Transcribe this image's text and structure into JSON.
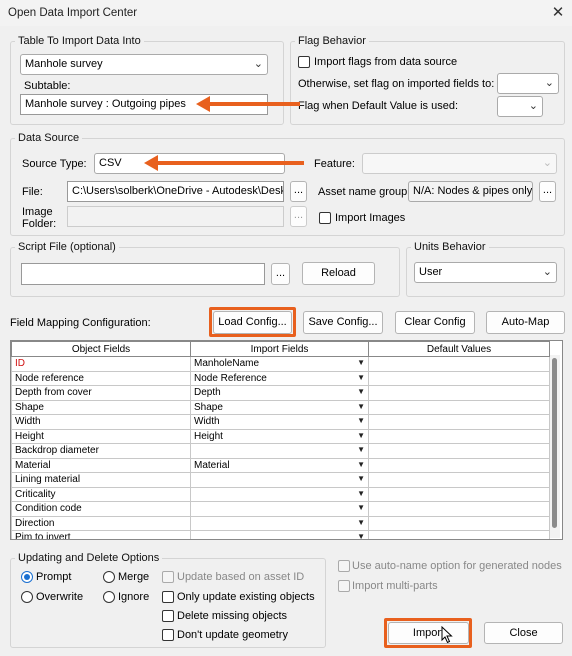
{
  "window": {
    "title": "Open Data Import Center",
    "close_glyph": "✕"
  },
  "table_group": {
    "legend": "Table To Import Data Into",
    "table_value": "Manhole survey",
    "subtable_label": "Subtable:",
    "subtable_value": "Manhole survey : Outgoing pipes"
  },
  "flag_group": {
    "legend": "Flag Behavior",
    "import_flags_label": "Import flags from data source",
    "otherwise_label": "Otherwise, set flag on imported fields to:",
    "default_value_label": "Flag when Default Value is used:"
  },
  "data_source": {
    "legend": "Data Source",
    "source_type_label": "Source Type:",
    "source_type_value": "CSV",
    "feature_label": "Feature:",
    "file_label": "File:",
    "file_value": "C:\\Users\\solberk\\OneDrive - Autodesk\\Desktop",
    "browse_label": "...",
    "asset_name_label": "Asset name group:",
    "asset_name_value": "N/A: Nodes & pipes only",
    "image_folder_label": "Image Folder:",
    "import_images_label": "Import Images"
  },
  "script_group": {
    "legend": "Script File (optional)",
    "browse_label": "...",
    "reload_label": "Reload"
  },
  "units_group": {
    "legend": "Units Behavior",
    "value": "User"
  },
  "mapping": {
    "label": "Field Mapping Configuration:",
    "load_config": "Load Config...",
    "save_config": "Save Config...",
    "clear_config": "Clear Config",
    "auto_map": "Auto-Map",
    "headers": [
      "Object Fields",
      "Import Fields",
      "Default Values"
    ],
    "rows": [
      {
        "field": "ID",
        "import": "ManholeName",
        "required": true
      },
      {
        "field": "Node reference",
        "import": "Node Reference",
        "required": false
      },
      {
        "field": "Depth from cover",
        "import": "Depth",
        "required": false
      },
      {
        "field": "Shape",
        "import": "Shape",
        "required": false
      },
      {
        "field": "Width",
        "import": "Width",
        "required": false
      },
      {
        "field": "Height",
        "import": "Height",
        "required": false
      },
      {
        "field": "Backdrop diameter",
        "import": "",
        "required": false
      },
      {
        "field": "Material",
        "import": "Material",
        "required": false
      },
      {
        "field": "Lining material",
        "import": "",
        "required": false
      },
      {
        "field": "Criticality",
        "import": "",
        "required": false
      },
      {
        "field": "Condition code",
        "import": "",
        "required": false
      },
      {
        "field": "Direction",
        "import": "",
        "required": false
      },
      {
        "field": "Pim to invert",
        "import": "",
        "required": false
      }
    ]
  },
  "update_group": {
    "legend": "Updating and Delete Options",
    "prompt": "Prompt",
    "merge": "Merge",
    "overwrite": "Overwrite",
    "ignore": "Ignore",
    "update_asset_id": "Update based on asset ID",
    "only_update_existing": "Only update existing objects",
    "delete_missing": "Delete missing objects",
    "dont_update_geometry": "Don't update geometry"
  },
  "options": {
    "auto_name": "Use auto-name option for generated nodes",
    "multi_parts": "Import multi-parts"
  },
  "footer": {
    "import_label": "Import",
    "close_label": "Close"
  },
  "colors": {
    "highlight": "#e8601e",
    "accent": "#1a6fd0",
    "required_text": "#d01010"
  }
}
